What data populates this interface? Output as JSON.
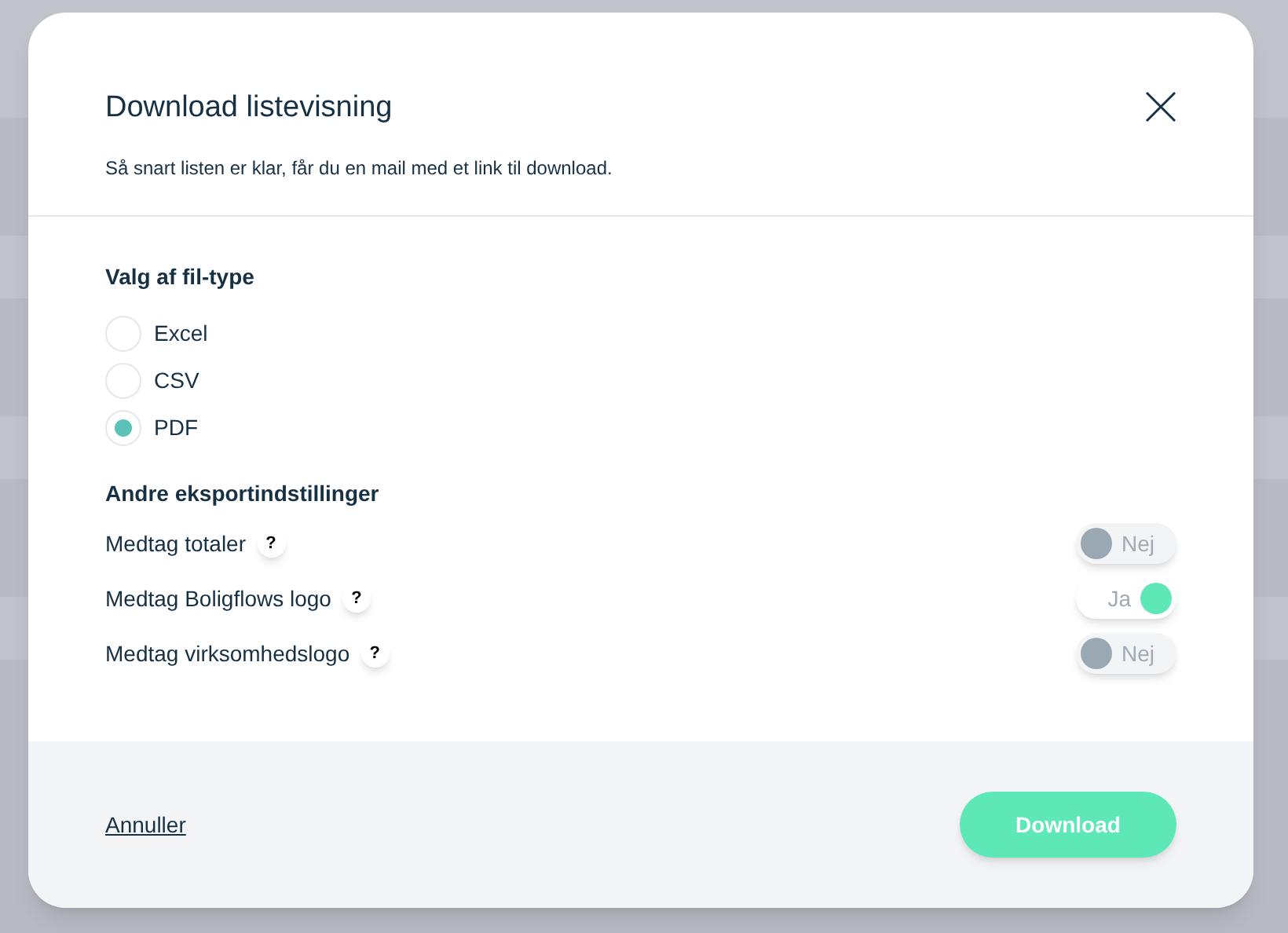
{
  "dialog": {
    "title": "Download listevisning",
    "subtitle": "Så snart listen er klar, får du en mail med et link til download."
  },
  "file_type": {
    "heading": "Valg af fil-type",
    "options": [
      {
        "label": "Excel",
        "selected": false
      },
      {
        "label": "CSV",
        "selected": false
      },
      {
        "label": "PDF",
        "selected": true
      }
    ]
  },
  "export_settings": {
    "heading": "Andre eksportindstillinger",
    "items": [
      {
        "label": "Medtag totaler",
        "help": "?",
        "on": false,
        "state_label": "Nej"
      },
      {
        "label": "Medtag Boligflows logo",
        "help": "?",
        "on": true,
        "state_label": "Ja"
      },
      {
        "label": "Medtag virksomhedslogo",
        "help": "?",
        "on": false,
        "state_label": "Nej"
      }
    ]
  },
  "footer": {
    "cancel": "Annuller",
    "download": "Download"
  }
}
